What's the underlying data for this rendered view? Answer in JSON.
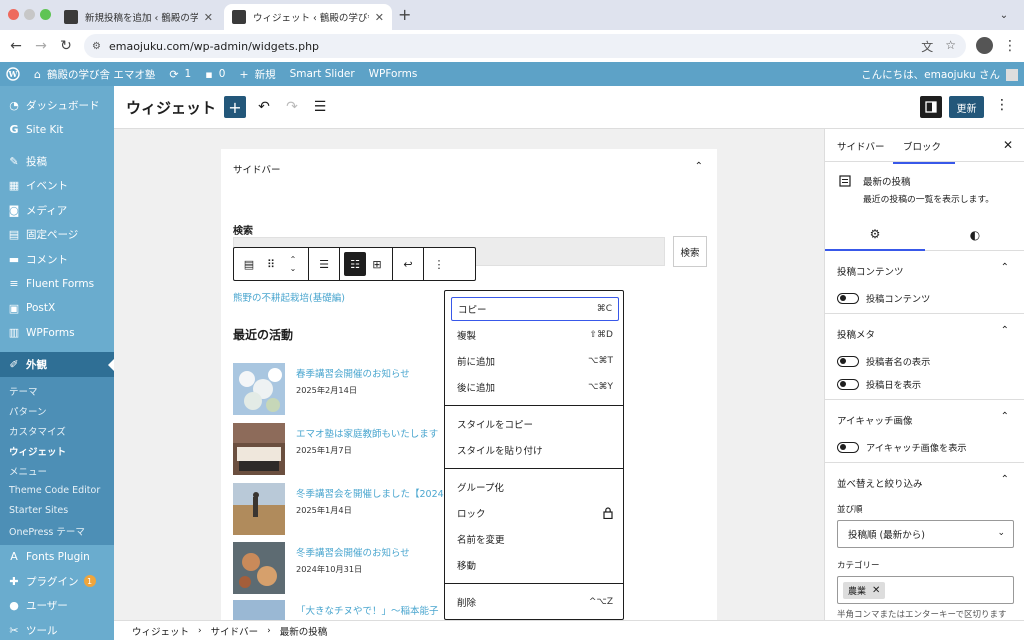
{
  "browser": {
    "tabs": [
      {
        "title": "新規投稿を追加 ‹ 鶴殿の学び舎 エマ"
      },
      {
        "title": "ウィジェット ‹ 鶴殿の学び舎 エマ"
      }
    ],
    "url": "emaojuku.com/wp-admin/widgets.php"
  },
  "adminbar": {
    "site_name": "鶴殿の学び舎 エマオ塾",
    "updates_count": "1",
    "comments_count": "0",
    "new_label": "新規",
    "smart_slider": "Smart Slider",
    "wpforms": "WPForms",
    "greeting": "こんにちは、emaojuku さん"
  },
  "sidemenu": {
    "items_top": [
      {
        "label": "ダッシュボード",
        "icon": "dashboard-icon"
      },
      {
        "label": "Site Kit",
        "icon": "google-icon"
      },
      {
        "label": "投稿",
        "icon": "pin-icon"
      },
      {
        "label": "イベント",
        "icon": "calendar-icon"
      },
      {
        "label": "メディア",
        "icon": "media-icon"
      },
      {
        "label": "固定ページ",
        "icon": "page-icon"
      },
      {
        "label": "コメント",
        "icon": "comment-icon"
      },
      {
        "label": "Fluent Forms",
        "icon": "form-icon"
      },
      {
        "label": "PostX",
        "icon": "postx-icon"
      },
      {
        "label": "WPForms",
        "icon": "wpforms-icon"
      }
    ],
    "current": "外観",
    "submenu": [
      "テーマ",
      "パターン",
      "カスタマイズ",
      "ウィジェット",
      "メニュー",
      "Theme Code Editor",
      "Starter Sites",
      "OnePress テーマ"
    ],
    "items_bottom": [
      {
        "label": "Fonts Plugin",
        "icon": "fonts-icon"
      },
      {
        "label": "プラグイン",
        "icon": "plugin-icon",
        "badge": "1"
      },
      {
        "label": "ユーザー",
        "icon": "user-icon"
      },
      {
        "label": "ツール",
        "icon": "tool-icon"
      }
    ]
  },
  "editor": {
    "title": "ウィジェット",
    "update_label": "更新"
  },
  "canvas": {
    "panel_title": "サイドバー",
    "search_label": "検索",
    "search_button": "検索",
    "recent_link": "熊野の不耕起栽培(基礎編)",
    "activity_title": "最近の活動",
    "posts": [
      {
        "title": "春季講習会開催のお知らせ",
        "date": "2025年2月14日"
      },
      {
        "title": "エマオ塾は家庭教師もいたします",
        "date": "2025年1月7日"
      },
      {
        "title": "冬季講習会を開催しました【2024",
        "date": "2025年1月4日"
      },
      {
        "title": "冬季講習会開催のお知らせ",
        "date": "2024年10月31日"
      },
      {
        "title": "「大きなチヌやで！」～稲本能子",
        "date": ""
      }
    ]
  },
  "context_menu": {
    "group1": [
      {
        "label": "コピー",
        "shortcut": "⌘C"
      },
      {
        "label": "複製",
        "shortcut": "⇧⌘D"
      },
      {
        "label": "前に追加",
        "shortcut": "⌥⌘T"
      },
      {
        "label": "後に追加",
        "shortcut": "⌥⌘Y"
      }
    ],
    "group2": [
      {
        "label": "スタイルをコピー"
      },
      {
        "label": "スタイルを貼り付け"
      }
    ],
    "group3": [
      {
        "label": "グループ化"
      },
      {
        "label": "ロック"
      },
      {
        "label": "名前を変更"
      },
      {
        "label": "移動"
      }
    ],
    "group4": [
      {
        "label": "削除",
        "shortcut": "^⌥Z"
      }
    ]
  },
  "inspector": {
    "tab_sidebar": "サイドバー",
    "tab_block": "ブロック",
    "block_title": "最新の投稿",
    "block_desc": "最近の投稿の一覧を表示します。",
    "sections": {
      "post_content": {
        "title": "投稿コンテンツ",
        "toggle": "投稿コンテンツ"
      },
      "post_meta": {
        "title": "投稿メタ",
        "toggle_author": "投稿者名の表示",
        "toggle_date": "投稿日を表示"
      },
      "featured": {
        "title": "アイキャッチ画像",
        "toggle": "アイキャッチ画像を表示"
      },
      "sorting": {
        "title": "並べ替えと絞り込み",
        "order_label": "並び順",
        "order_value": "投稿順 (最新から)",
        "category_label": "カテゴリー",
        "category_token": "農業",
        "hint": "半角コンマまたはエンターキーで区切ります"
      }
    }
  },
  "breadcrumb": [
    "ウィジェット",
    "サイドバー",
    "最新の投稿"
  ],
  "colors": {
    "admin_bar": "#5da2c7",
    "sidebar": "#6aacce",
    "sidebar_current": "#2f6f95",
    "accent": "#23577a",
    "link": "#4aa6cf",
    "focus": "#3858e9"
  }
}
